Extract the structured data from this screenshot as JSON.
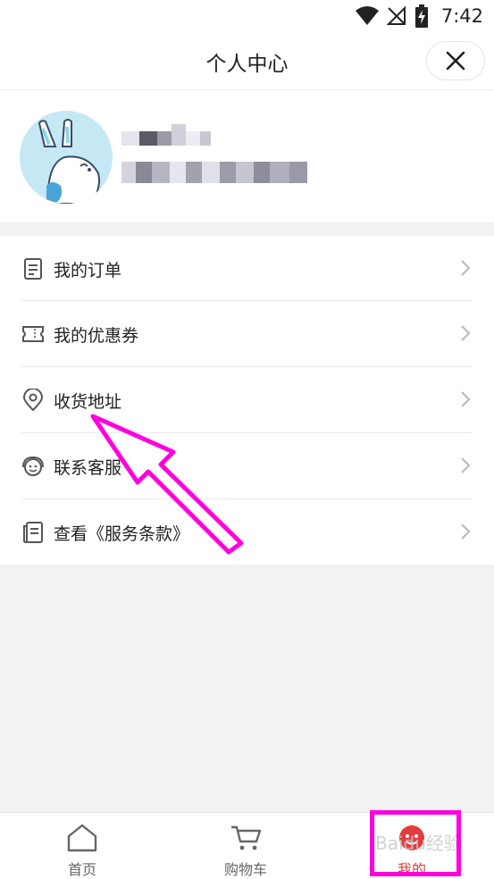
{
  "status": {
    "time": "7:42"
  },
  "header": {
    "title": "个人中心"
  },
  "menu": {
    "items": [
      {
        "label": "我的订单",
        "icon": "order-list-icon"
      },
      {
        "label": "我的优惠券",
        "icon": "coupon-ticket-icon"
      },
      {
        "label": "收货地址",
        "icon": "location-pin-icon"
      },
      {
        "label": "联系客服",
        "icon": "customer-service-icon"
      },
      {
        "label": "查看《服务条款》",
        "icon": "terms-document-icon"
      }
    ]
  },
  "tabbar": {
    "tabs": [
      {
        "label": "首页",
        "icon": "home-icon"
      },
      {
        "label": "购物车",
        "icon": "cart-icon"
      },
      {
        "label": "我的",
        "icon": "profile-face-icon",
        "active": true
      }
    ]
  },
  "colors": {
    "accent": "#e23d3d",
    "annotation": "#ff00dd",
    "background": "#f2f2f2"
  },
  "watermark": {
    "text": "Baidu经验"
  }
}
